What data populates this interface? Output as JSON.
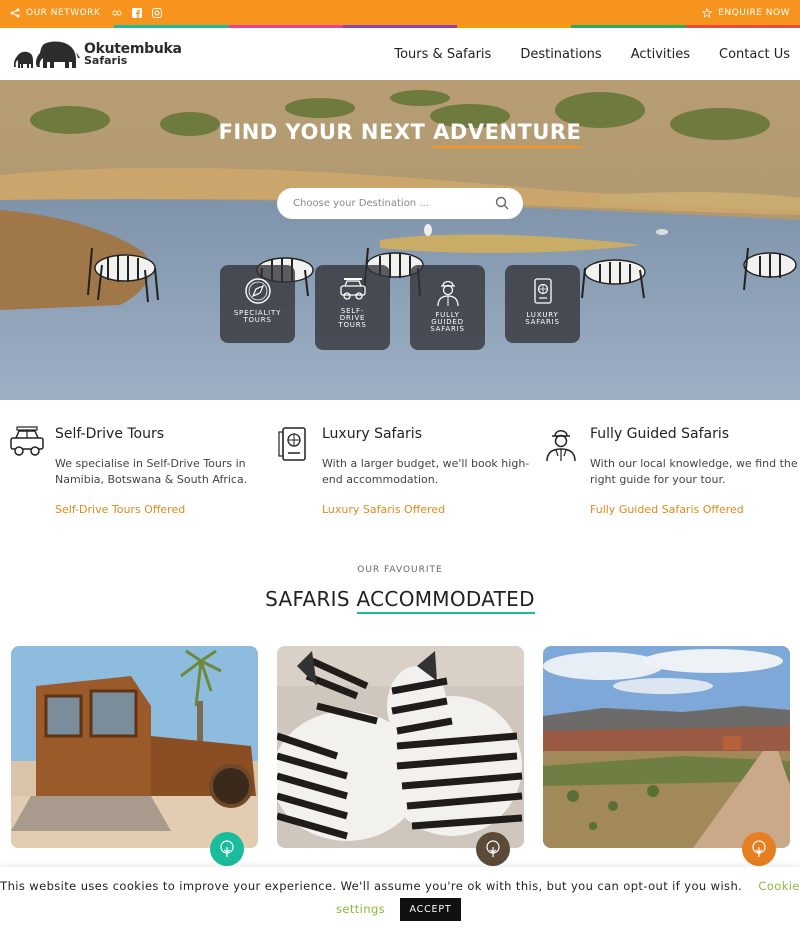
{
  "topbar": {
    "network_label": "OUR NETWORK",
    "enquire_label": "ENQUIRE NOW",
    "strip_colors": [
      "#f7941d",
      "#1abc9c",
      "#e84393",
      "#8e44ad",
      "#f39c12",
      "#27ae60",
      "#e74c3c"
    ]
  },
  "brand": {
    "name_line1": "Okutembuka",
    "name_line2": "Safaris"
  },
  "nav": {
    "items": [
      "Tours & Safaris",
      "Destinations",
      "Activities",
      "Contact Us"
    ]
  },
  "hero": {
    "title_part1": "FIND YOUR NEXT ",
    "title_part2": "ADVENTURE",
    "search_placeholder": "Choose your Destination ...",
    "tiles": [
      {
        "icon": "compass-icon",
        "label": "SPECIALITY TOURS"
      },
      {
        "icon": "jeep-icon",
        "label": "SELF-DRIVE TOURS"
      },
      {
        "icon": "guide-icon",
        "label": "FULLY GUIDED SAFARIS"
      },
      {
        "icon": "passport-icon",
        "label": "LUXURY SAFARIS"
      }
    ]
  },
  "features": [
    {
      "icon": "jeep-icon",
      "title": "Self-Drive Tours",
      "text": "We specialise in Self-Drive Tours in Namibia, Botswana & South Africa.",
      "link": "Self-Drive Tours Offered"
    },
    {
      "icon": "passport-icon",
      "title": "Luxury Safaris",
      "text": "With a larger budget, we'll book high-end accommodation.",
      "link": "Luxury Safaris Offered"
    },
    {
      "icon": "guide-icon",
      "title": "Fully Guided Safaris",
      "text": "With our local knowledge, we find the right guide for your tour.",
      "link": "Fully Guided Safaris Offered"
    }
  ],
  "section": {
    "subtitle": "OUR FAVOURITE",
    "title_part1": "SAFARIS ",
    "title_part2": "ACCOMMODATED"
  },
  "cards": [
    {
      "image": "rusty-truck-photo",
      "badge_color": "#1abc9c"
    },
    {
      "image": "zebras-photo",
      "badge_color": "#5b4a38"
    },
    {
      "image": "desert-road-photo",
      "badge_color": "#e67e22"
    }
  ],
  "cookie": {
    "message": "This website uses cookies to improve your experience. We'll assume you're ok with this, but you can opt-out if you wish.",
    "settings_label_1": "Cookie",
    "settings_label_2": "settings",
    "accept_label": "ACCEPT"
  },
  "accent_color": "#f7941d"
}
